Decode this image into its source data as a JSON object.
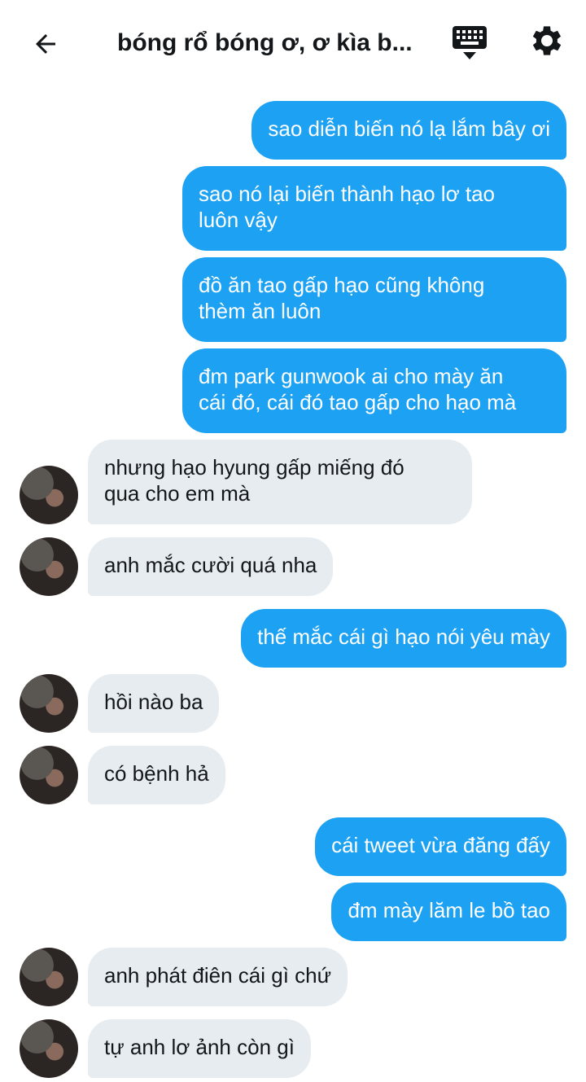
{
  "header": {
    "title": "bóng rổ bóng ơ, ơ kìa b...",
    "back_icon": "arrow-left-icon",
    "keyboard_icon": "keyboard-icon",
    "settings_icon": "gear-icon"
  },
  "colors": {
    "outgoing_bubble": "#1da1f2",
    "incoming_bubble": "#e6ecf0"
  },
  "messages": [
    {
      "from": "me",
      "text": "sao diễn biến nó lạ lắm bây ơi"
    },
    {
      "from": "me",
      "text": "sao nó lại biến thành hạo lơ tao\nluôn vậy"
    },
    {
      "from": "me",
      "text": "đồ ăn tao gấp hạo cũng không\nthèm ăn luôn"
    },
    {
      "from": "me",
      "text": "đm park gunwook ai cho mày ăn\ncái đó, cái đó tao gấp cho hạo mà"
    },
    {
      "from": "them",
      "text": "nhưng hạo hyung gấp miếng đó\nqua cho em mà"
    },
    {
      "from": "them",
      "text": "anh mắc cười quá nha"
    },
    {
      "from": "me",
      "text": "thế mắc cái gì hạo nói yêu mày"
    },
    {
      "from": "them",
      "text": "hồi nào ba"
    },
    {
      "from": "them",
      "text": "có bệnh hả"
    },
    {
      "from": "me",
      "text": "cái tweet vừa đăng đấy"
    },
    {
      "from": "me",
      "text": "đm mày lăm le bồ tao"
    },
    {
      "from": "them",
      "text": "anh phát điên cái gì chứ"
    },
    {
      "from": "them",
      "text": "tự anh lơ ảnh còn gì"
    }
  ]
}
